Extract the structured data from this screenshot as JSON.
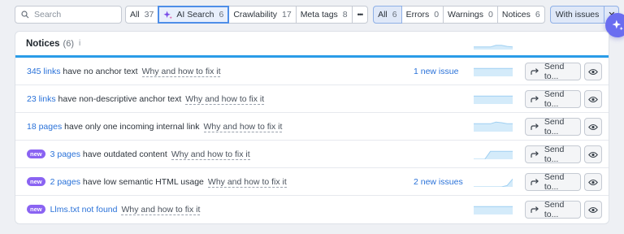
{
  "search": {
    "placeholder": "Search"
  },
  "category_filters": [
    {
      "label": "All",
      "count": "37"
    },
    {
      "label": "AI Search",
      "count": "6"
    },
    {
      "label": "Crawlability",
      "count": "17"
    },
    {
      "label": "Meta tags",
      "count": "8"
    },
    {
      "label": "•••"
    }
  ],
  "type_filters": [
    {
      "label": "All",
      "count": "6"
    },
    {
      "label": "Errors",
      "count": "0"
    },
    {
      "label": "Warnings",
      "count": "0"
    },
    {
      "label": "Notices",
      "count": "6"
    }
  ],
  "with_issues": {
    "label": "With issues",
    "close": "✕"
  },
  "panel": {
    "title": "Notices",
    "count": "(6)",
    "info": "i"
  },
  "rows": [
    {
      "badge": "",
      "link": "345 links",
      "text": " have no anchor text",
      "fix": "Why and how to fix it",
      "new_issues": "1 new issue",
      "send": "Send to...",
      "trend": [
        3,
        3,
        3,
        3,
        3,
        3,
        3,
        3
      ]
    },
    {
      "badge": "",
      "link": "23 links",
      "text": " have non-descriptive anchor text",
      "fix": "Why and how to fix it",
      "new_issues": "",
      "send": "Send to...",
      "trend": [
        3,
        3,
        3,
        3,
        3,
        3,
        3,
        3
      ]
    },
    {
      "badge": "",
      "link": "18 pages",
      "text": " have only one incoming internal link",
      "fix": "Why and how to fix it",
      "new_issues": "",
      "send": "Send to...",
      "trend": [
        3,
        3,
        3,
        3,
        3.6,
        3.4,
        3,
        3
      ]
    },
    {
      "badge": "new",
      "link": "3 pages",
      "text": " have outdated content",
      "fix": "Why and how to fix it",
      "new_issues": "",
      "send": "Send to...",
      "trend": [
        0,
        0,
        0,
        3,
        3,
        3,
        3,
        3
      ]
    },
    {
      "badge": "new",
      "link": "2 pages",
      "text": " have low semantic HTML usage",
      "fix": "Why and how to fix it",
      "new_issues": "2 new issues",
      "send": "Send to...",
      "trend": [
        0,
        0,
        0,
        0,
        0,
        0,
        0.5,
        3
      ]
    },
    {
      "badge": "new",
      "link": "Llms.txt not found",
      "text": "",
      "fix": "Why and how to fix it",
      "new_issues": "",
      "send": "Send to...",
      "trend": [
        3,
        3,
        3,
        3,
        3,
        3,
        3,
        3
      ]
    }
  ],
  "header_trend": [
    1,
    1,
    1,
    1,
    1.6,
    1.6,
    1.2,
    1
  ],
  "colors": {
    "accent": "#2a72d9",
    "tab_underline": "#2a9ce8",
    "new_badge": "#8a63f2",
    "fab": "#6a6df0",
    "sparkline": "#9fd0f2"
  }
}
